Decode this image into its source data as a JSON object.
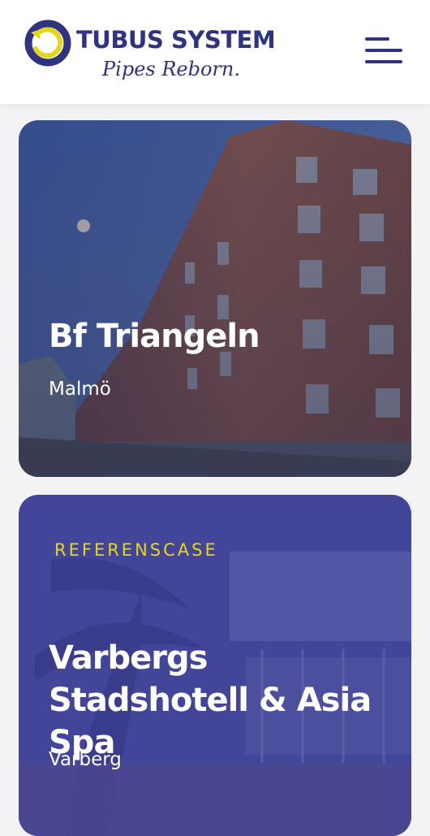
{
  "header": {
    "brand_name": "TUBUS SYSTEM",
    "brand_tagline": "Pipes Reborn.",
    "menu_icon": "hamburger-menu-icon",
    "colors": {
      "brand": "#2f3380",
      "accent": "#e6d51a"
    }
  },
  "cards": [
    {
      "eyebrow": "",
      "title": "Bf Triangeln",
      "location": "Malmö"
    },
    {
      "eyebrow": "REFERENSCASE",
      "title": "Varbergs Stadshotell & Asia Spa",
      "location": "Varberg"
    }
  ]
}
